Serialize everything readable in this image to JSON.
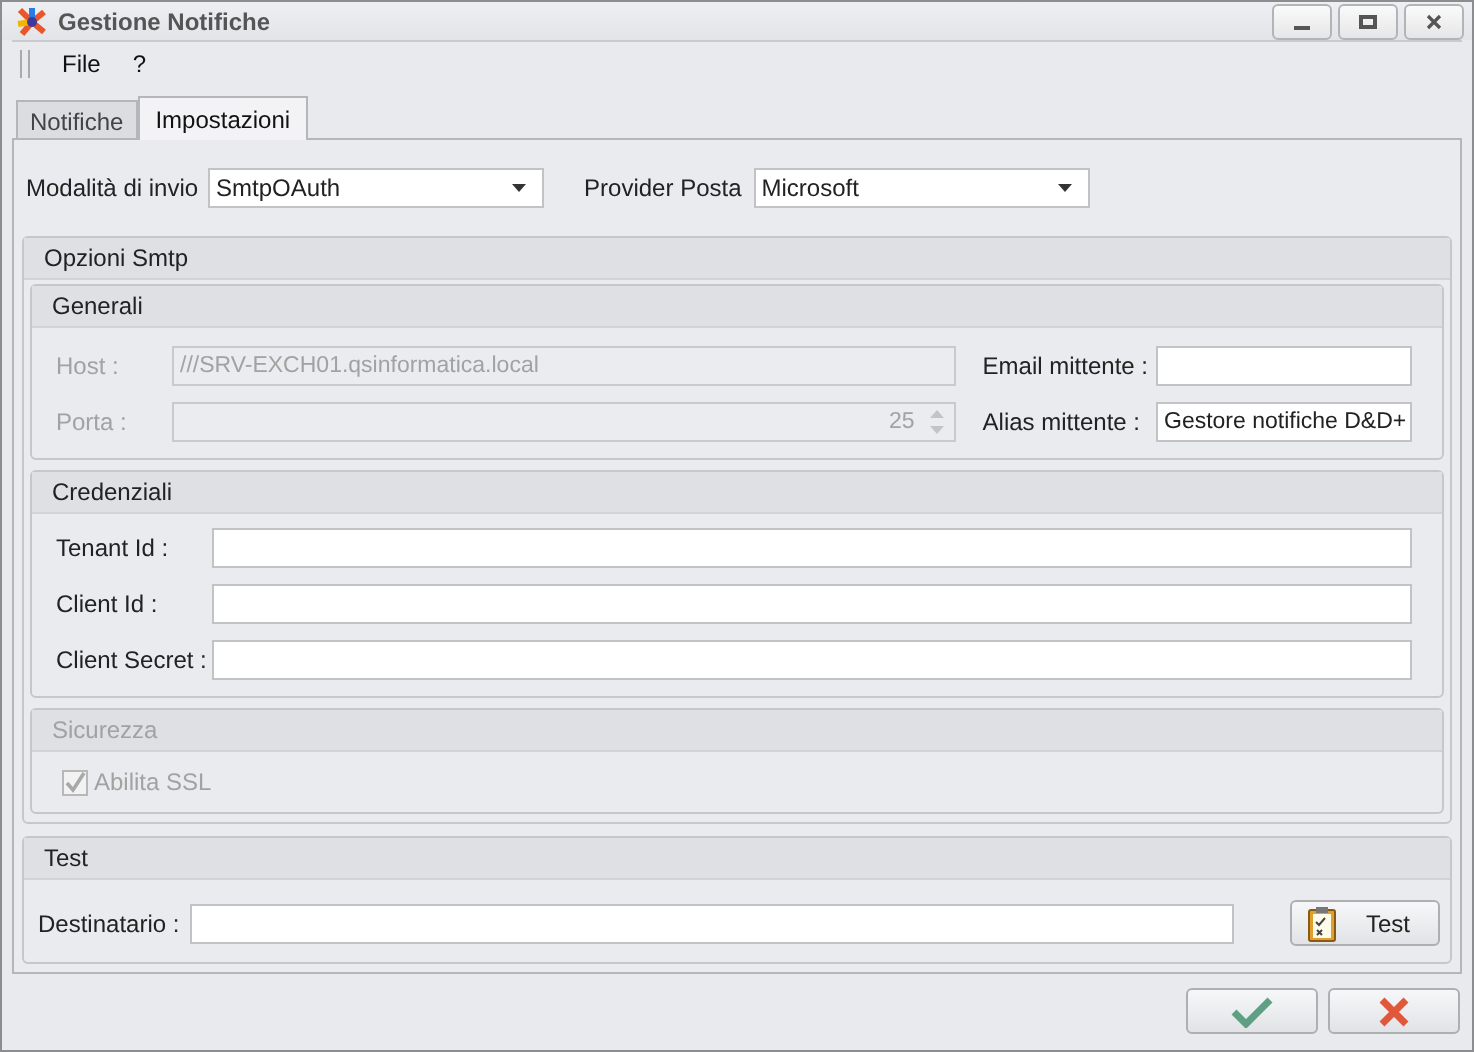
{
  "window": {
    "title": "Gestione Notifiche"
  },
  "menu": [
    {
      "label": "File"
    },
    {
      "label": "?"
    }
  ],
  "tabs": [
    {
      "label": "Notifiche",
      "selected": false
    },
    {
      "label": "Impostazioni",
      "selected": true
    }
  ],
  "send_mode": {
    "label": "Modalità di invio",
    "value": "SmtpOAuth"
  },
  "provider": {
    "label": "Provider Posta",
    "value": "Microsoft"
  },
  "smtp_group": {
    "title": "Opzioni Smtp",
    "general": {
      "title": "Generali",
      "host": {
        "label": "Host :",
        "value": "///SRV-EXCH01.qsinformatica.local",
        "disabled": true
      },
      "port": {
        "label": "Porta :",
        "value": "25",
        "disabled": true
      },
      "sender_email": {
        "label": "Email mittente :"
      },
      "sender_alias": {
        "label": "Alias mittente :",
        "value": "Gestore notifiche D&D+"
      }
    },
    "credentials": {
      "title": "Credenziali",
      "fields": [
        {
          "label": "Tenant Id :"
        },
        {
          "label": "Client Id :"
        },
        {
          "label": "Client Secret :"
        }
      ]
    },
    "security": {
      "title": "Sicurezza",
      "disabled": true,
      "ssl": {
        "label": "Abilita SSL",
        "checked": true
      }
    }
  },
  "test_group": {
    "title": "Test",
    "recipient": {
      "label": "Destinatario :"
    },
    "button": "Test"
  }
}
